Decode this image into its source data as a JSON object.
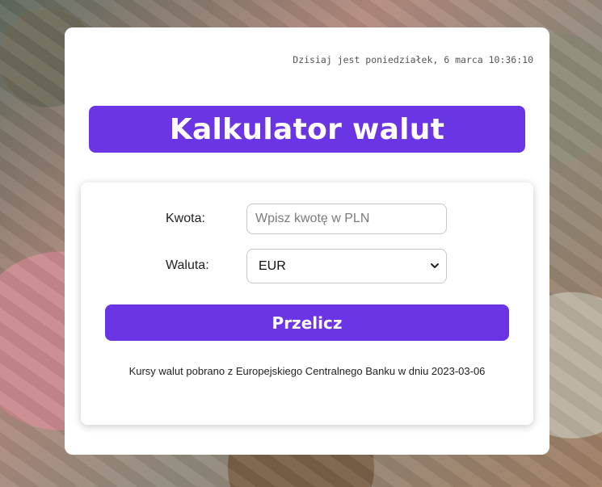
{
  "header": {
    "date_text": "Dzisiaj jest poniedziałek, 6 marca 10:36:10",
    "title": "Kalkulator walut"
  },
  "form": {
    "amount_label": "Kwota:",
    "amount_placeholder": "Wpisz kwotę w PLN",
    "amount_value": "",
    "currency_label": "Waluta:",
    "currency_selected": "EUR",
    "submit_label": "Przelicz",
    "note": "Kursy walut pobrano z Europejskiego Centralnego Banku w dniu 2023-03-06"
  },
  "colors": {
    "accent": "#6b35e6",
    "card": "#ffffff"
  },
  "icons": {
    "select_chevron": "chevron-down-icon"
  }
}
